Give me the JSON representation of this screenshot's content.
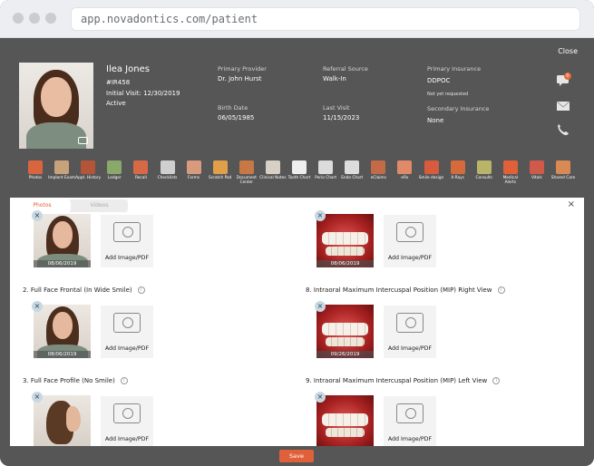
{
  "browser": {
    "url": "app.novadontics.com/patient"
  },
  "header": {
    "close_label": "Close",
    "patient": {
      "name": "Ilea Jones",
      "id": "#IR458",
      "initial_visit": "Initial Visit: 12/30/2019",
      "status": "Active"
    },
    "primary_provider": {
      "label": "Primary Provider",
      "value": "Dr. John Hurst"
    },
    "birth_date": {
      "label": "Birth Date",
      "value": "06/05/1985"
    },
    "referral_source": {
      "label": "Referral Source",
      "value": "Walk-In"
    },
    "last_visit": {
      "label": "Last Visit",
      "value": "11/15/2023"
    },
    "primary_insurance": {
      "label": "Primary Insurance",
      "value": "DDPOC",
      "note": "Not yet requested"
    },
    "secondary_insurance": {
      "label": "Secondary Insurance",
      "value": "None"
    },
    "chat_badge": "0"
  },
  "toolbar": [
    {
      "label": "Photos",
      "color": "#d9653f"
    },
    {
      "label": "Implant Exam",
      "color": "#c8a27a"
    },
    {
      "label": "Appt. History",
      "color": "#b4553a"
    },
    {
      "label": "Ledger",
      "color": "#8aa86a"
    },
    {
      "label": "Recall",
      "color": "#d66a46"
    },
    {
      "label": "Checklists",
      "color": "#cfcfcf"
    },
    {
      "label": "Forms",
      "color": "#d99b7d"
    },
    {
      "label": "Scratch Pad",
      "color": "#e0a04a"
    },
    {
      "label": "Document Center",
      "color": "#c77845"
    },
    {
      "label": "Clinical Notes",
      "color": "#d8d0c4"
    },
    {
      "label": "Tooth Chart",
      "color": "#eeeeee"
    },
    {
      "label": "Perio Chart",
      "color": "#dcdcdc"
    },
    {
      "label": "Endo Chart",
      "color": "#dcdcdc"
    },
    {
      "label": "eClaims",
      "color": "#c46a47"
    },
    {
      "label": "eRx",
      "color": "#e08a6a"
    },
    {
      "label": "Smile design",
      "color": "#d95b3d"
    },
    {
      "label": "X-Rays",
      "color": "#d56a3a"
    },
    {
      "label": "Consults",
      "color": "#b9b46a"
    },
    {
      "label": "Medical Alerts",
      "color": "#e0603a"
    },
    {
      "label": "Vitals",
      "color": "#d05a4a"
    },
    {
      "label": "Shared Care",
      "color": "#d88a55"
    }
  ],
  "modal": {
    "tabs": {
      "photos": "Photos",
      "videos": "Videos"
    },
    "close": "×",
    "add_label": "Add Image/PDF",
    "left": [
      {
        "title": "",
        "date": "08/06/2019"
      },
      {
        "title": "2. Full Face Frontal (In Wide Smile)",
        "date": "08/06/2019"
      },
      {
        "title": "3. Full Face Profile (No Smile)",
        "date": ""
      }
    ],
    "right": [
      {
        "title": "",
        "date": "08/06/2019"
      },
      {
        "title": "8. Intraoral Maximum Intercuspal Position (MIP) Right View",
        "date": "09/26/2019"
      },
      {
        "title": "9. Intraoral Maximum Intercuspal Position (MIP) Left View",
        "date": ""
      }
    ]
  },
  "footer": {
    "save_label": "Save"
  }
}
